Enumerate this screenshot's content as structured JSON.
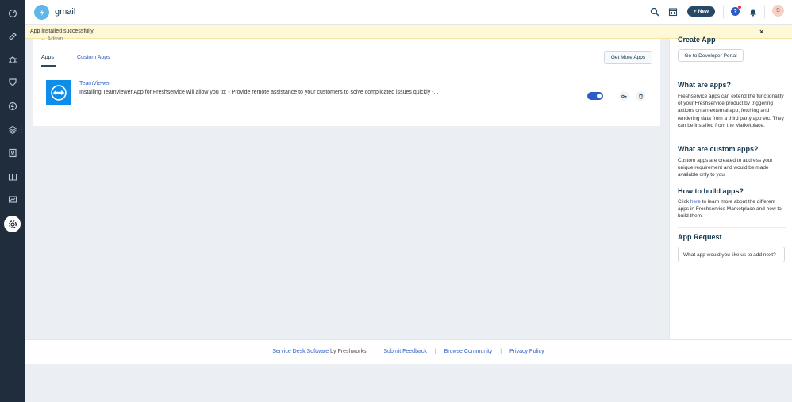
{
  "header": {
    "workspace_name": "gmail",
    "new_button_label": "New",
    "help_icon_label": "?",
    "avatar_initial": "S"
  },
  "toast": {
    "message": "App installed successfully.",
    "close_label": "×"
  },
  "breadcrumb": {
    "fragment": "← Admin"
  },
  "tabs": {
    "apps_label": "Apps",
    "custom_apps_label": "Custom Apps"
  },
  "get_more_apps_label": "Get More Apps",
  "installed_app": {
    "name": "TeamViewer",
    "description": "Installing Teamviewer App for Freshservice will allow you to: - Provide remote assistance to your customers to solve complicated issues quickly -...",
    "enabled": true
  },
  "right_panel": {
    "create_app_heading": "Create App",
    "developer_portal_button": "Go to Developer Portal",
    "what_are_apps_heading": "What are apps?",
    "what_are_apps_body": "Freshservice apps can extend the functionality of your Freshservice product by triggering actions on an external app, fetching and rendering data from a third party app etc. They can be installed from the Marketplace.",
    "custom_apps_heading": "What are custom apps?",
    "custom_apps_body": "Custom apps are created to address your unique requirement and would be made available only to you.",
    "build_apps_heading": "How to build apps?",
    "build_apps_prefix": "Click ",
    "build_apps_link": "here",
    "build_apps_suffix": " to learn more about the different apps in Freshservice Marketplace and how to build them.",
    "app_request_heading": "App Request",
    "app_request_placeholder": "What app would you like us to add next?"
  },
  "footer": {
    "service_desk_link": "Service Desk Software",
    "by_text": " by Freshworks",
    "separator": "|",
    "submit_feedback": "Submit Feedback",
    "browse_community": "Browse Community",
    "privacy_policy": "Privacy Policy"
  },
  "colors": {
    "sidebar_bg": "#1f2d3d",
    "accent": "#2c5cc5",
    "toast_bg": "#fef8d6",
    "teamviewer_blue": "#0e8ee9"
  }
}
